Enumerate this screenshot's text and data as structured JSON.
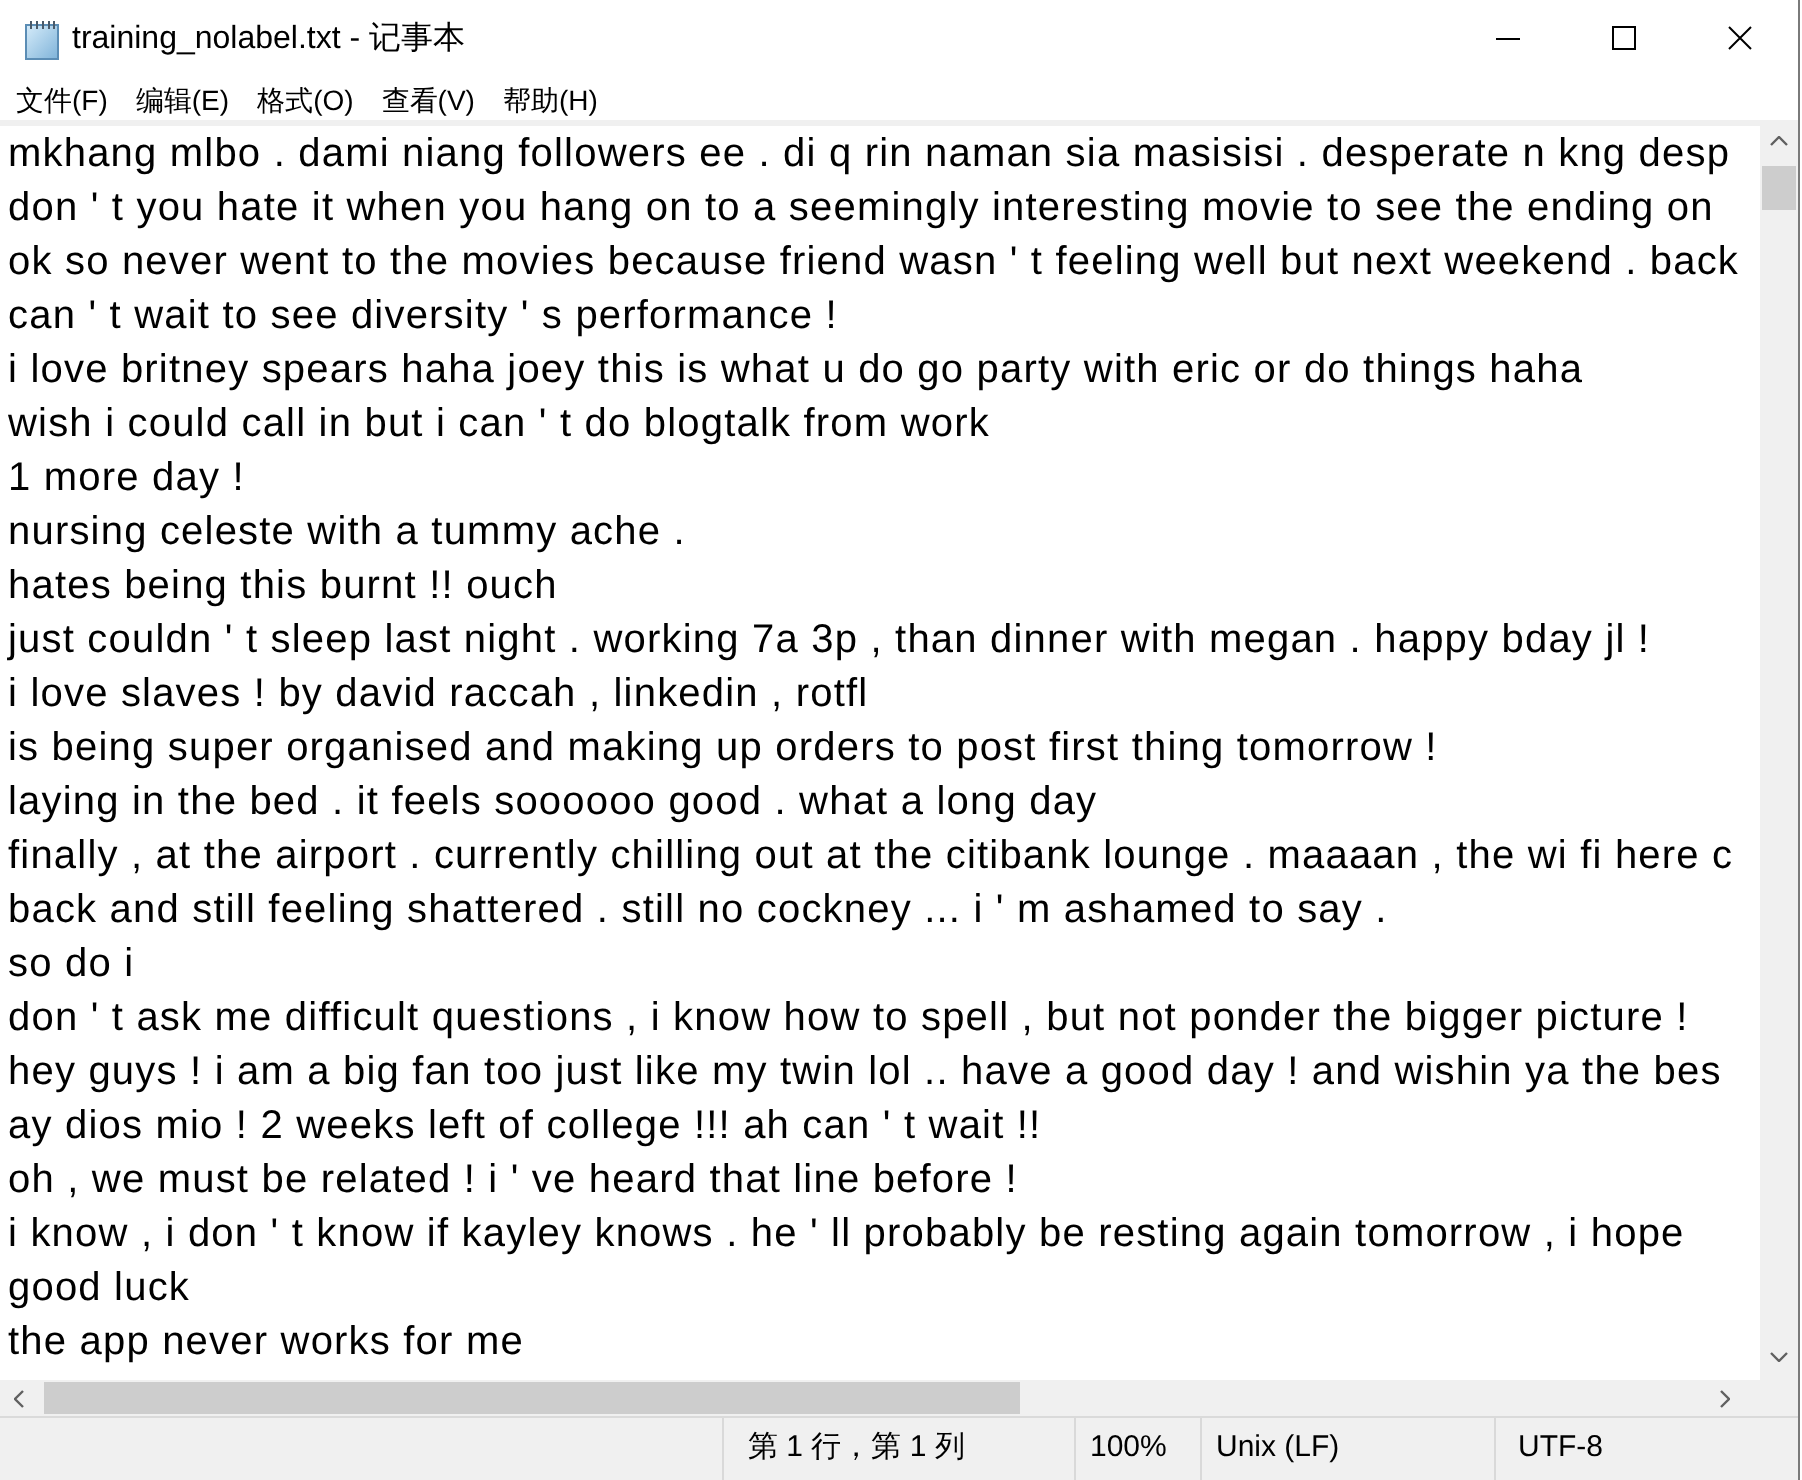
{
  "window": {
    "title": "training_nolabel.txt - 记事本"
  },
  "menu_bar": [
    "文件(F)",
    "编辑(E)",
    "格式(O)",
    "查看(V)",
    "帮助(H)"
  ],
  "editor": {
    "lines": [
      "mkhang mlbo . dami niang followers ee . di q rin naman sia masisisi . desperate n kng desp",
      "don ' t you hate it when you hang on to a seemingly interesting movie to see the ending on",
      "ok so never went to the movies because friend wasn ' t feeling well but next weekend . back",
      "can ' t wait to see diversity ' s performance !",
      "i love britney spears haha joey this is what u do go party with eric or do things haha",
      "wish i could call in but i can ' t do blogtalk from work",
      "1 more day !",
      "nursing celeste with a tummy ache .",
      "hates being this burnt !! ouch",
      "just couldn ' t sleep last night . working 7a 3p , than dinner with megan . happy bday jl !",
      "i love slaves ! by david raccah , linkedin , rotfl",
      "is being super organised and making up orders to post first thing tomorrow !",
      "laying in the bed . it feels soooooo good . what a long day",
      "finally , at the airport . currently chilling out at the citibank lounge . maaaan , the wi fi here c",
      "back and still feeling shattered . still no cockney ... i ' m ashamed to say .",
      "so do i",
      "don ' t ask me difficult questions , i know how to spell , but not ponder the bigger picture !",
      "hey guys ! i am a big fan too just like my twin lol .. have a good day ! and wishin ya the bes",
      "ay dios mio ! 2 weeks left of college !!! ah can ' t wait !!",
      "oh , we must be related ! i ' ve heard that line before !",
      "i know , i don ' t know if kayley knows . he ' ll probably be resting again tomorrow , i hope",
      "good luck",
      "the app never works for me"
    ]
  },
  "status_bar": {
    "position": "第 1 行，第 1 列",
    "zoom": "100%",
    "line_ending": "Unix (LF)",
    "encoding": "UTF-8"
  }
}
